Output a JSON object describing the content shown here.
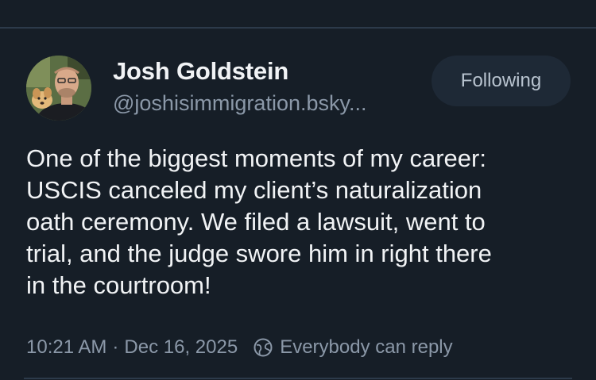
{
  "author": {
    "display_name": "Josh Goldstein",
    "handle": "@joshisimmigration.bsky..."
  },
  "follow_button": {
    "label": "Following"
  },
  "post": {
    "lines": [
      "One of the biggest moments of my career:",
      "USCIS canceled my client’s naturalization",
      "oath ceremony. We filed a lawsuit, went to",
      "trial, and the judge swore him in right there",
      "in the courtroom!"
    ]
  },
  "meta": {
    "time": "10:21 AM",
    "separator": "·",
    "date": "Dec 16, 2025",
    "reply_setting": "Everybody can reply",
    "reply_icon": "globe-icon"
  },
  "colors": {
    "background": "#161e27",
    "text": "#f1f3f5",
    "muted": "#8b98a8",
    "button_bg": "#1e2936",
    "divider": "#2c3a4a"
  }
}
